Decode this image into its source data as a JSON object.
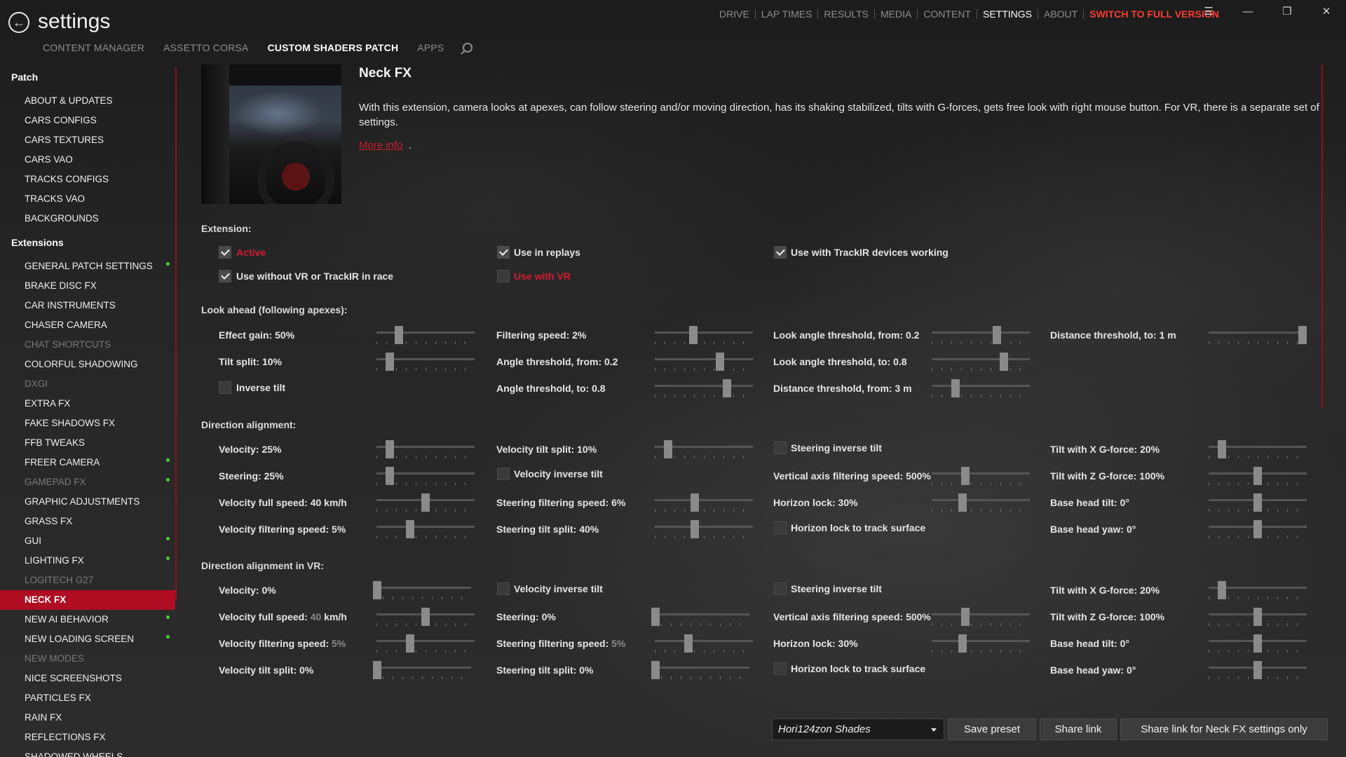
{
  "app": {
    "title": "settings",
    "back_icon": "back-arrow-icon"
  },
  "topnav": {
    "items": [
      "DRIVE",
      "LAP TIMES",
      "RESULTS",
      "MEDIA",
      "CONTENT",
      "SETTINGS",
      "ABOUT"
    ],
    "active": "SETTINGS",
    "full_version": "SWITCH TO FULL VERSION"
  },
  "subnav": {
    "items": [
      "CONTENT MANAGER",
      "ASSETTO CORSA",
      "CUSTOM SHADERS PATCH",
      "APPS"
    ],
    "active": "CUSTOM SHADERS PATCH"
  },
  "window_controls": [
    "menu-icon",
    "minimize-icon",
    "restore-icon",
    "close-icon"
  ],
  "sidebar": {
    "patch_header": "Patch",
    "patch_items": [
      "ABOUT & UPDATES",
      "CARS CONFIGS",
      "CARS TEXTURES",
      "CARS VAO",
      "TRACKS CONFIGS",
      "TRACKS VAO",
      "BACKGROUNDS"
    ],
    "extensions_header": "Extensions",
    "extension_items": [
      {
        "label": "GENERAL PATCH SETTINGS",
        "dot": true,
        "dim": false
      },
      {
        "label": "BRAKE DISC FX",
        "dot": false,
        "dim": false
      },
      {
        "label": "CAR INSTRUMENTS",
        "dot": false,
        "dim": false
      },
      {
        "label": "CHASER CAMERA",
        "dot": false,
        "dim": false
      },
      {
        "label": "CHAT SHORTCUTS",
        "dot": false,
        "dim": true
      },
      {
        "label": "COLORFUL SHADOWING",
        "dot": false,
        "dim": false
      },
      {
        "label": "DXGI",
        "dot": false,
        "dim": true
      },
      {
        "label": "EXTRA FX",
        "dot": false,
        "dim": false
      },
      {
        "label": "FAKE SHADOWS FX",
        "dot": false,
        "dim": false
      },
      {
        "label": "FFB TWEAKS",
        "dot": false,
        "dim": false
      },
      {
        "label": "FREER CAMERA",
        "dot": true,
        "dim": false
      },
      {
        "label": "GAMEPAD FX",
        "dot": true,
        "dim": true
      },
      {
        "label": "GRAPHIC ADJUSTMENTS",
        "dot": false,
        "dim": false
      },
      {
        "label": "GRASS FX",
        "dot": false,
        "dim": false
      },
      {
        "label": "GUI",
        "dot": true,
        "dim": false
      },
      {
        "label": "LIGHTING FX",
        "dot": true,
        "dim": false
      },
      {
        "label": "LOGITECH G27",
        "dot": false,
        "dim": true
      },
      {
        "label": "NECK FX",
        "dot": false,
        "dim": false,
        "selected": true
      },
      {
        "label": "NEW AI BEHAVIOR",
        "dot": true,
        "dim": false
      },
      {
        "label": "NEW LOADING SCREEN",
        "dot": true,
        "dim": false
      },
      {
        "label": "NEW MODES",
        "dot": false,
        "dim": true
      },
      {
        "label": "NICE SCREENSHOTS",
        "dot": false,
        "dim": false
      },
      {
        "label": "PARTICLES FX",
        "dot": false,
        "dim": false
      },
      {
        "label": "RAIN FX",
        "dot": false,
        "dim": false
      },
      {
        "label": "REFLECTIONS FX",
        "dot": false,
        "dim": false
      },
      {
        "label": "SHADOWED WHEELS",
        "dot": false,
        "dim": false
      }
    ]
  },
  "feature": {
    "title": "Neck FX",
    "description": "With this extension, camera looks at apexes, can follow steering and/or moving direction, has its shaking stabilized, tilts with G-forces, gets free look with right mouse button. For VR, there is a separate set of settings.",
    "more_info": "More info",
    "more_info_suffix": "."
  },
  "extension": {
    "label": "Extension:",
    "active": "Active",
    "use_in_replays": "Use in replays",
    "use_with_trackir": "Use with TrackIR devices working",
    "use_without_vr": "Use without VR or TrackIR in race",
    "use_with_vr": "Use with VR"
  },
  "look_ahead": {
    "label": "Look ahead (following apexes):",
    "effect_gain": "Effect gain: 50%",
    "filtering_speed": "Filtering speed: 2%",
    "look_angle_from": "Look angle threshold, from: 0.2",
    "distance_to": "Distance threshold, to: 1 m",
    "tilt_split": "Tilt split: 10%",
    "angle_from": "Angle threshold, from: 0.2",
    "look_angle_to": "Look angle threshold, to: 0.8",
    "inverse_tilt": "Inverse tilt",
    "angle_to": "Angle threshold, to: 0.8",
    "distance_from": "Distance threshold, from: 3 m",
    "levels": {
      "effect_gain": 0.2,
      "filtering_speed": 0.38,
      "look_angle_from": 0.68,
      "distance_to": 1.0,
      "tilt_split": 0.1,
      "angle_from": 0.68,
      "look_angle_to": 0.76,
      "angle_to": 0.76,
      "distance_from": 0.22
    }
  },
  "direction": {
    "label": "Direction alignment:",
    "velocity": "Velocity: 25%",
    "velocity_tilt_split": "Velocity tilt split: 10%",
    "steering_inverse_tilt": "Steering inverse tilt",
    "tilt_x": "Tilt with X G-force: 20%",
    "steering": "Steering: 25%",
    "velocity_inverse_tilt": "Velocity inverse tilt",
    "vertical_filter": "Vertical axis filtering speed: 500%",
    "tilt_z": "Tilt with Z G-force: 100%",
    "velocity_full_speed": "Velocity full speed: 40 km/h",
    "steering_filter": "Steering filtering speed: 6%",
    "horizon_lock": "Horizon lock: 30%",
    "base_head_tilt": "Base head tilt: 0°",
    "velocity_filter": "Velocity filtering speed: 5%",
    "steering_tilt_split": "Steering tilt split: 40%",
    "horizon_lock_track": "Horizon lock to track surface",
    "base_head_yaw": "Base head yaw: 0°",
    "levels": {
      "velocity": 0.1,
      "velocity_tilt_split": 0.1,
      "tilt_x": 0.1,
      "steering": 0.1,
      "vertical_filter": 0.33,
      "tilt_z": 0.5,
      "velocity_full_speed": 0.5,
      "steering_filter": 0.4,
      "horizon_lock": 0.3,
      "base_head_tilt": 0.5,
      "velocity_filter": 0.33,
      "steering_tilt_split": 0.4,
      "base_head_yaw": 0.5
    }
  },
  "direction_vr": {
    "label": "Direction alignment in VR:",
    "velocity": "Velocity: 0%",
    "velocity_inverse_tilt": "Velocity inverse tilt",
    "steering_inverse_tilt": "Steering inverse tilt",
    "tilt_x": "Tilt with X G-force: 20%",
    "velocity_full_speed_prefix": "Velocity full speed: ",
    "velocity_full_speed_value": "40",
    "velocity_full_speed_unit": " km/h",
    "steering": "Steering: 0%",
    "vertical_filter": "Vertical axis filtering speed: 500%",
    "tilt_z": "Tilt with Z G-force: 100%",
    "velocity_filter_prefix": "Velocity filtering speed: ",
    "velocity_filter_value": "5%",
    "steering_filter_prefix": "Steering filtering speed: ",
    "steering_filter_value": "5%",
    "horizon_lock": "Horizon lock: 30%",
    "base_head_tilt": "Base head tilt: 0°",
    "velocity_tilt_split": "Velocity tilt split: 0%",
    "steering_tilt_split": "Steering tilt split: 0%",
    "horizon_lock_track": "Horizon lock to track surface",
    "base_head_yaw": "Base head yaw: 0°",
    "levels": {
      "velocity": 0.0,
      "tilt_x": 0.1,
      "velocity_full_speed": 0.5,
      "steering": 0.0,
      "vertical_filter": 0.33,
      "tilt_z": 0.5,
      "velocity_filter": 0.33,
      "steering_filter": 0.33,
      "horizon_lock": 0.3,
      "base_head_tilt": 0.5,
      "velocity_tilt_split": 0.0,
      "steering_tilt_split": 0.0,
      "base_head_yaw": 0.5
    }
  },
  "footer": {
    "preset_value": "Hori124zon Shades",
    "save_preset": "Save preset",
    "share_link": "Share link",
    "share_link_only": "Share link for Neck FX settings only"
  }
}
